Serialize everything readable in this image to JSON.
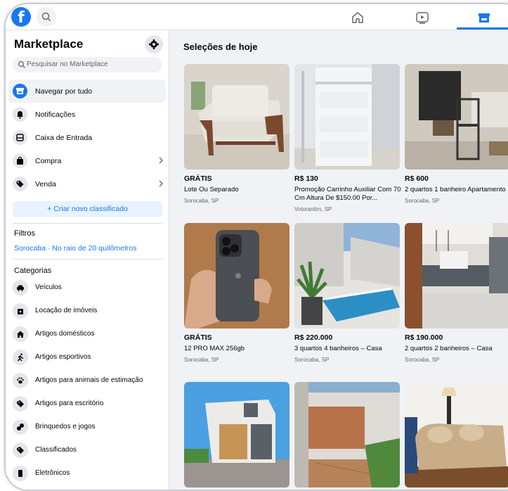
{
  "colors": {
    "accent": "#1877f2",
    "bg": "#f0f2f5",
    "muted": "#65676b"
  },
  "topbar": {
    "logo_letter": "f",
    "icons": [
      "facebook-logo-icon",
      "search-icon",
      "home-icon",
      "video-icon",
      "marketplace-icon"
    ]
  },
  "sidebar": {
    "title": "Marketplace",
    "search_placeholder": "Pesquisar no Marketplace",
    "menu": [
      {
        "label": "Navegar por tudo",
        "icon": "storefront-icon",
        "active": true
      },
      {
        "label": "Notificações",
        "icon": "bell-icon"
      },
      {
        "label": "Caixa de Entrada",
        "icon": "inbox-icon"
      },
      {
        "label": "Compra",
        "icon": "shopping-bag-icon",
        "chevron": true
      },
      {
        "label": "Venda",
        "icon": "tag-icon",
        "chevron": true
      }
    ],
    "create_label": "+ Criar novo classificado",
    "filters_title": "Filtros",
    "filter_value": "Sorocaba · No raio de 20 quilômetros",
    "categories_title": "Categorias",
    "categories": [
      {
        "label": "Veículos",
        "icon": "car-icon"
      },
      {
        "label": "Locação de imóveis",
        "icon": "house-key-icon"
      },
      {
        "label": "Artigos domésticos",
        "icon": "home-icon"
      },
      {
        "label": "Artigos esportivos",
        "icon": "running-icon"
      },
      {
        "label": "Artigos para animais de estimação",
        "icon": "paw-icon"
      },
      {
        "label": "Artigos para escritório",
        "icon": "tag-icon"
      },
      {
        "label": "Brinquedos e jogos",
        "icon": "puzzle-icon"
      },
      {
        "label": "Classificados",
        "icon": "tag-icon"
      },
      {
        "label": "Eletrônicos",
        "icon": "phone-icon"
      }
    ]
  },
  "main": {
    "title": "Seleções de hoje",
    "listings": [
      {
        "price": "GRÁTIS",
        "title": "Lote Ou Separado",
        "location": "Sorocaba, SP"
      },
      {
        "price": "R$ 130",
        "title": "Promoção Carrinho Auxiliar Com 70 Cm Altura De $150.00 Por...",
        "location": "Votorantim, SP"
      },
      {
        "price": "R$ 600",
        "title": "2 quartos 1 banheiro Apartamento",
        "location": "Sorocaba, SP"
      },
      {
        "price": "GRÁTIS",
        "title": "12 PRO MAX 256gb",
        "location": "Sorocaba, SP"
      },
      {
        "price": "R$ 220.000",
        "title": "3 quartos 4 banheiros – Casa",
        "location": "Sorocaba, SP"
      },
      {
        "price": "R$ 190.000",
        "title": "2 quartos 2 banheiros – Casa",
        "location": "Sorocaba, SP"
      },
      {
        "price": "",
        "title": "",
        "location": ""
      },
      {
        "price": "",
        "title": "",
        "location": ""
      },
      {
        "price": "",
        "title": "",
        "location": ""
      }
    ]
  }
}
